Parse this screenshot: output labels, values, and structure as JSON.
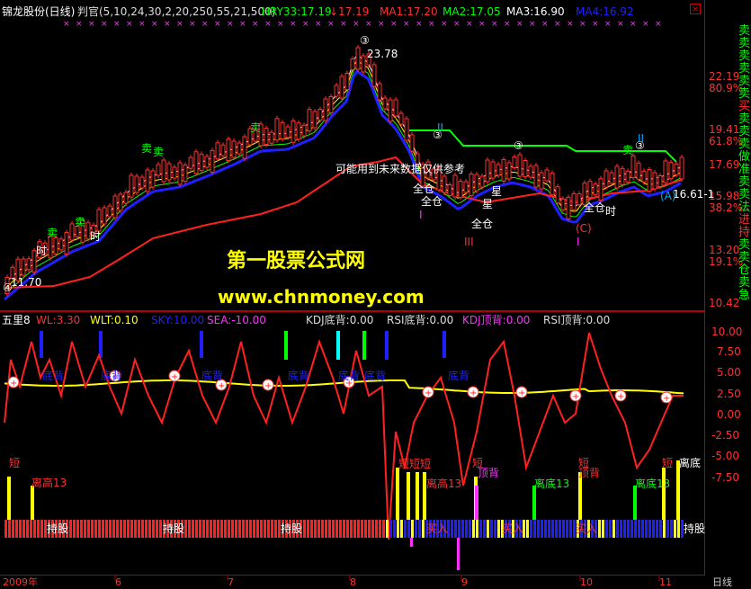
{
  "main_header": {
    "title": "锦龙股份(日线)",
    "indicator_name": "判官(5,10,24,30,2,20,250,55,21,500)",
    "hry": "HRY33:17.19",
    "hry_arrow": "↓17.19",
    "ma1": "MA1:17.20",
    "ma2": "MA2:17.05",
    "ma3": "MA3:16.90",
    "ma4": "MA4:16.92"
  },
  "price_axis": [
    "22.19",
    "80.9%",
    "19.41",
    "61.8%",
    "17.69",
    "15.98",
    "38.2%",
    "13.20",
    "19.1%",
    "10.42"
  ],
  "price_labels": {
    "high": "23.78",
    "low": "11.70",
    "last": "16.61-1"
  },
  "watermark": {
    "line1": "第一股票公式网",
    "line2": "www.chnmoney.com"
  },
  "side_text": [
    "卖",
    "卖",
    "卖",
    "卖",
    "卖",
    "卖",
    "买",
    "卖",
    "卖",
    "卖",
    "做",
    "准",
    "卖",
    "卖",
    "法",
    "进",
    "持",
    "卖",
    "卖",
    "仓",
    "卖",
    "急"
  ],
  "sub_header": {
    "name": "五里8",
    "wl": "WL:3.30",
    "wlt": "WLT:0.10",
    "sky": "SKY:10.00",
    "sea": "SEA:-10.00",
    "kdj_bottom": "KDJ底背:0.00",
    "rsi_bottom": "RSI底背:0.00",
    "kdj_top": "KDJ顶背:0.00",
    "rsi_top": "RSI顶背:0.00"
  },
  "sub_axis": [
    "10.00",
    "7.50",
    "5.00",
    "2.50",
    "0.00",
    "-2.50",
    "-5.00",
    "-7.50"
  ],
  "annotations": {
    "sell": "卖",
    "buy": "买",
    "time": "时",
    "full": "全仓",
    "star": "星",
    "future_note": "可能用到未来数据仅供参考",
    "hold": "持股",
    "short": "短",
    "bottom_dev": "底背",
    "top_dev": "顶背",
    "off_high": "离高13",
    "off_low": "离底13",
    "off_bottom": "离底",
    "buy_in": "买入",
    "circle3": "③",
    "circle4": "④",
    "roman2": "II",
    "roman3": "III",
    "roman1": "I",
    "c_mark": "(C)",
    "a_mark": "(A)"
  },
  "date_axis": [
    "2009年",
    "6",
    "7",
    "8",
    "9",
    "10",
    "11"
  ],
  "period": "日线",
  "colors": {
    "up": "#ff3030",
    "down": "#00ffff",
    "ma_white": "#ffffff",
    "ma_yellow": "#ffff00",
    "ma_green": "#00ff00",
    "ma_blue": "#2020ff",
    "border": "#b00000",
    "wl": "#ff2020",
    "wlt": "#ffff00"
  }
}
